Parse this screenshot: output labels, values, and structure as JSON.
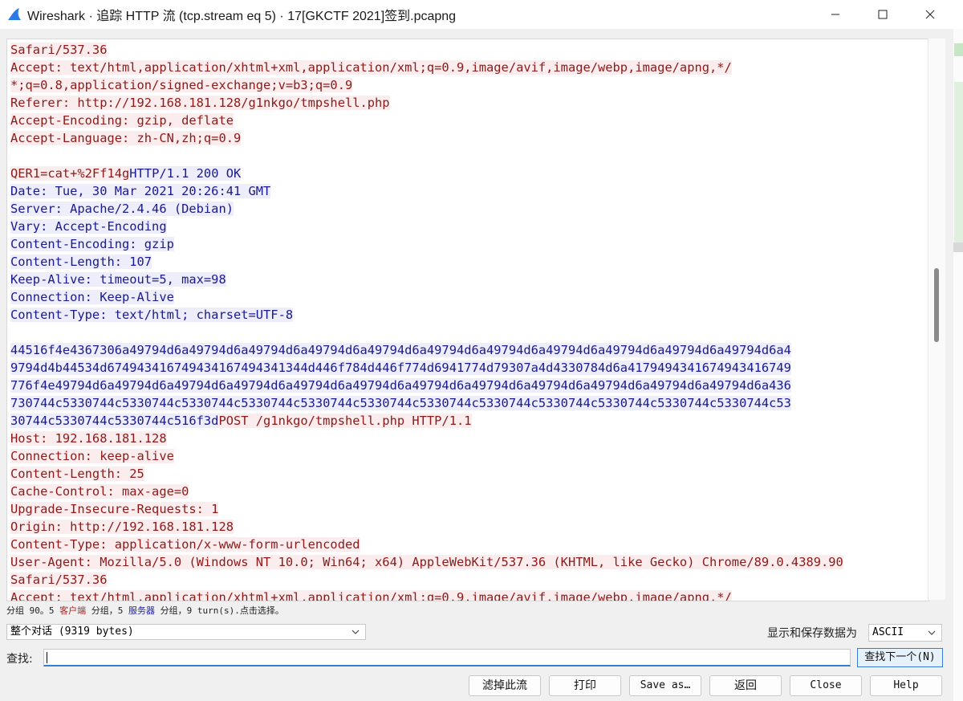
{
  "window": {
    "title": "Wireshark · 追踪 HTTP 流 (tcp.stream eq 5) · 17[GKCTF 2021]签到.pcapng",
    "minimize_label": "—",
    "maximize_label": "☐",
    "close_label": "✕"
  },
  "stream": {
    "lines": [
      {
        "segs": [
          {
            "t": "Safari/537.36",
            "c": "client"
          }
        ]
      },
      {
        "segs": [
          {
            "t": "Accept: text/html,application/xhtml+xml,application/xml;q=0.9,image/avif,image/webp,image/apng,*/",
            "c": "client"
          }
        ]
      },
      {
        "segs": [
          {
            "t": "*;q=0.8,application/signed-exchange;v=b3;q=0.9",
            "c": "client"
          }
        ]
      },
      {
        "segs": [
          {
            "t": "Referer: http://192.168.181.128/g1nkgo/tmpshell.php",
            "c": "client"
          }
        ]
      },
      {
        "segs": [
          {
            "t": "Accept-Encoding: gzip, deflate",
            "c": "client"
          }
        ]
      },
      {
        "segs": [
          {
            "t": "Accept-Language: zh-CN,zh;q=0.9",
            "c": "client"
          }
        ]
      },
      {
        "segs": []
      },
      {
        "segs": [
          {
            "t": "QER1=cat+%2Ff14g",
            "c": "client"
          },
          {
            "t": "HTTP/1.1 200 OK",
            "c": "server"
          }
        ]
      },
      {
        "segs": [
          {
            "t": "Date: Tue, 30 Mar 2021 20:26:41 GMT",
            "c": "server"
          }
        ]
      },
      {
        "segs": [
          {
            "t": "Server: Apache/2.4.46 (Debian)",
            "c": "server"
          }
        ]
      },
      {
        "segs": [
          {
            "t": "Vary: Accept-Encoding",
            "c": "server"
          }
        ]
      },
      {
        "segs": [
          {
            "t": "Content-Encoding: gzip",
            "c": "server"
          }
        ]
      },
      {
        "segs": [
          {
            "t": "Content-Length: 107",
            "c": "server"
          }
        ]
      },
      {
        "segs": [
          {
            "t": "Keep-Alive: timeout=5, max=98",
            "c": "server"
          }
        ]
      },
      {
        "segs": [
          {
            "t": "Connection: Keep-Alive",
            "c": "server"
          }
        ]
      },
      {
        "segs": [
          {
            "t": "Content-Type: text/html; charset=UTF-8",
            "c": "server"
          }
        ]
      },
      {
        "segs": []
      },
      {
        "segs": [
          {
            "t": "44516f4e4367306a49794d6a49794d6a49794d6a49794d6a49794d6a49794d6a49794d6a49794d6a49794d6a49794d6a49794d6a4",
            "c": "server"
          }
        ]
      },
      {
        "segs": [
          {
            "t": "9794d4b44534d674943416749434167494341344d446f784d446f774d6941774d79307a4d4330784d6a4179494341674943416749",
            "c": "server"
          }
        ]
      },
      {
        "segs": [
          {
            "t": "776f4e49794d6a49794d6a49794d6a49794d6a49794d6a49794d6a49794d6a49794d6a49794d6a49794d6a49794d6a49794d6a436",
            "c": "server"
          }
        ]
      },
      {
        "segs": [
          {
            "t": "730744c5330744c5330744c5330744c5330744c5330744c5330744c5330744c5330744c5330744c5330744c5330744c5330744c53",
            "c": "server"
          }
        ]
      },
      {
        "segs": [
          {
            "t": "30744c5330744c5330744c516f3d",
            "c": "server"
          },
          {
            "t": "POST /g1nkgo/tmpshell.php HTTP/1.1",
            "c": "client"
          }
        ]
      },
      {
        "segs": [
          {
            "t": "Host: 192.168.181.128",
            "c": "client"
          }
        ]
      },
      {
        "segs": [
          {
            "t": "Connection: keep-alive",
            "c": "client"
          }
        ]
      },
      {
        "segs": [
          {
            "t": "Content-Length: 25",
            "c": "client"
          }
        ]
      },
      {
        "segs": [
          {
            "t": "Cache-Control: max-age=0",
            "c": "client"
          }
        ]
      },
      {
        "segs": [
          {
            "t": "Upgrade-Insecure-Requests: 1",
            "c": "client"
          }
        ]
      },
      {
        "segs": [
          {
            "t": "Origin: http://192.168.181.128",
            "c": "client"
          }
        ]
      },
      {
        "segs": [
          {
            "t": "Content-Type: application/x-www-form-urlencoded",
            "c": "client"
          }
        ]
      },
      {
        "segs": [
          {
            "t": "User-Agent: Mozilla/5.0 (Windows NT 10.0; Win64; x64) AppleWebKit/537.36 (KHTML, like Gecko) Chrome/89.0.4389.90",
            "c": "client"
          }
        ]
      },
      {
        "segs": [
          {
            "t": "Safari/537.36",
            "c": "client"
          }
        ]
      },
      {
        "segs": [
          {
            "t": "Accept: text/html,application/xhtml+xml,application/xml;q=0.9,image/avif,image/webp,image/apng,*/",
            "c": "client"
          }
        ]
      }
    ]
  },
  "status": {
    "prefix": "分组 90。5 ",
    "client_label": "客户端",
    "middle": " 分组，5 ",
    "server_label": "服务器",
    "suffix": " 分组，9 turn(s).点击选择。"
  },
  "conversation_select": {
    "value": "整个对话 (9319 bytes)"
  },
  "show_as": {
    "label": "显示和保存数据为",
    "value": "ASCII"
  },
  "find": {
    "label": "查找:",
    "value": "",
    "next_label": "查找下一个(N)"
  },
  "buttons": {
    "filter_out": "滤掉此流",
    "print": "打印",
    "save_as": "Save as…",
    "back": "返回",
    "close": "Close",
    "help": "Help"
  },
  "colors": {
    "client_fg": "#8b1a1a",
    "client_bg": "#fbeded",
    "server_fg": "#1a1a8b",
    "server_bg": "#ededfb"
  }
}
